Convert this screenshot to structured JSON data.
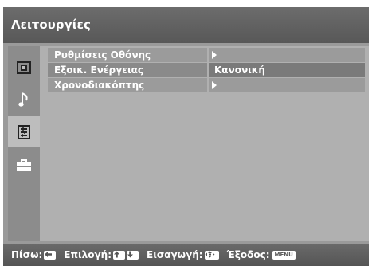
{
  "title": "Λειτουργίες",
  "sidebar": {
    "items": [
      {
        "icon": "picture-icon"
      },
      {
        "icon": "music-note-icon"
      },
      {
        "icon": "features-icon",
        "selected": true
      },
      {
        "icon": "toolbox-icon"
      }
    ]
  },
  "menu": {
    "rows": [
      {
        "label": "Ρυθμίσεις Οθόνης",
        "value": "",
        "has_submenu": true
      },
      {
        "label": "Εξοικ. Ενέργειας",
        "value": "Κανονική",
        "has_submenu": false,
        "highlighted": true
      },
      {
        "label": "Χρονοδιακόπτης",
        "value": "",
        "has_submenu": true
      }
    ]
  },
  "footer": {
    "back_label": "Πίσω:",
    "select_label": "Επιλογή:",
    "enter_label": "Εισαγωγή:",
    "exit_label": "Έξοδος:",
    "menu_key": "MENU"
  },
  "colors": {
    "frame": "#9a9a9a",
    "header": "#606060",
    "content": "#b0b0b0",
    "highlight": "#7a7a7a"
  }
}
